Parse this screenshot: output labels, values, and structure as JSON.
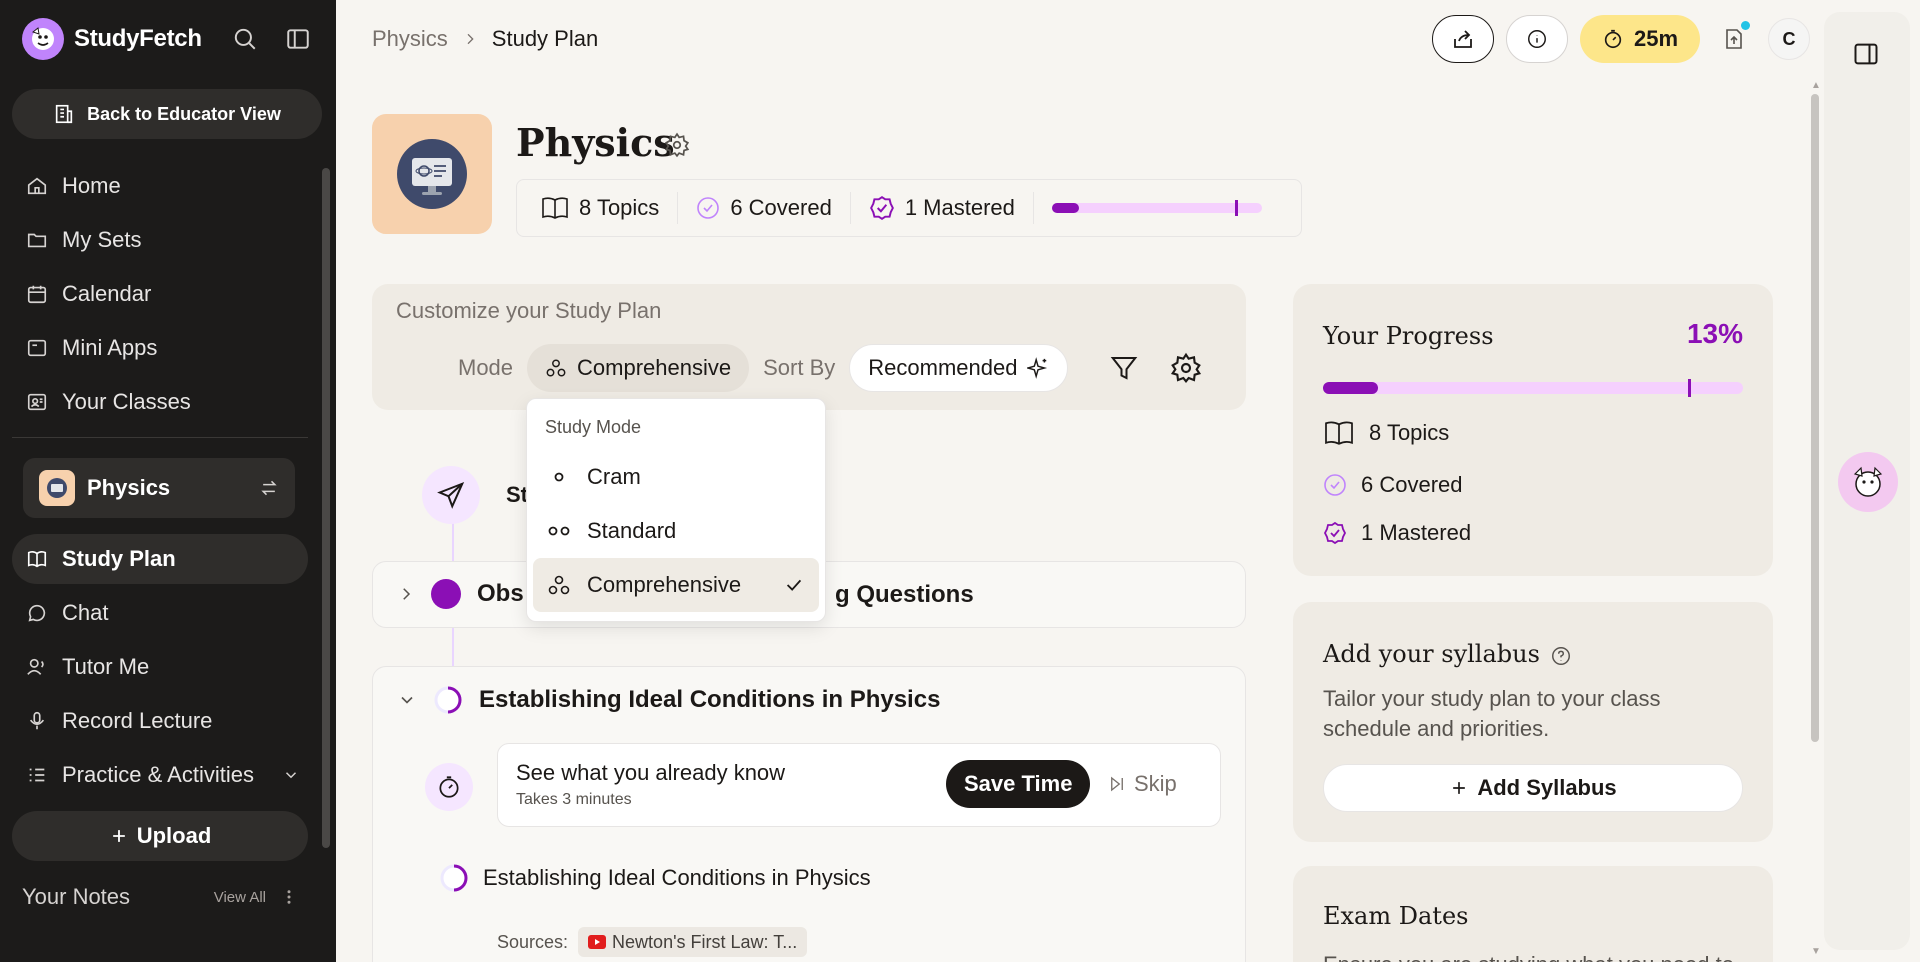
{
  "brand": {
    "name": "StudyFetch"
  },
  "sidebar": {
    "back_label": "Back to Educator View",
    "nav_top": [
      {
        "label": "Home",
        "icon": "home-icon"
      },
      {
        "label": "My Sets",
        "icon": "folder-icon"
      },
      {
        "label": "Calendar",
        "icon": "calendar-icon"
      },
      {
        "label": "Mini Apps",
        "icon": "app-icon"
      },
      {
        "label": "Your Classes",
        "icon": "classes-icon"
      }
    ],
    "current_class": "Physics",
    "nav_class": [
      {
        "label": "Study Plan",
        "icon": "book-icon",
        "active": true
      },
      {
        "label": "Chat",
        "icon": "chat-icon"
      },
      {
        "label": "Tutor Me",
        "icon": "tutor-icon"
      },
      {
        "label": "Record Lecture",
        "icon": "mic-icon"
      },
      {
        "label": "Practice & Activities",
        "icon": "list-icon"
      }
    ],
    "upload_label": "Upload",
    "notes_title": "Your Notes",
    "notes_view_all": "View All"
  },
  "breadcrumb": {
    "parent": "Physics",
    "current": "Study Plan"
  },
  "topbar": {
    "timer_label": "25m",
    "avatar_initial": "C"
  },
  "header": {
    "title": "Physics",
    "topics": "8 Topics",
    "covered": "6 Covered",
    "mastered": "1 Mastered",
    "progress": {
      "mastered_fraction": 0.13,
      "covered_fraction": 0.87
    }
  },
  "customize": {
    "title": "Customize your Study Plan",
    "mode_label": "Mode",
    "mode_value": "Comprehensive",
    "sort_label": "Sort By",
    "sort_value": "Recommended"
  },
  "dropdown": {
    "title": "Study Mode",
    "options": [
      {
        "label": "Cram",
        "selected": false
      },
      {
        "label": "Standard",
        "selected": false
      },
      {
        "label": "Comprehensive",
        "selected": true
      }
    ]
  },
  "plan": {
    "start_text": "St",
    "topic1_title_start": "Obs",
    "topic1_title_end": "g Questions",
    "topic2_title": "Establishing Ideal Conditions in Physics",
    "know_title": "See what you already know",
    "know_sub": "Takes 3 minutes",
    "save_label": "Save Time",
    "skip_label": "Skip",
    "subtopic": "Establishing Ideal Conditions in Physics",
    "sources_label": "Sources:",
    "source_chip": "Newton's First Law: T..."
  },
  "progress_card": {
    "title": "Your Progress",
    "percent": "13%",
    "topics": "8 Topics",
    "covered": "6 Covered",
    "mastered": "1 Mastered"
  },
  "syllabus_card": {
    "title": "Add your syllabus",
    "desc": "Tailor your study plan to your class schedule and priorities.",
    "button": "Add Syllabus"
  },
  "exam_card": {
    "title": "Exam Dates",
    "desc": "Ensure you are studying what you need to"
  },
  "colors": {
    "accent": "#8b0fb5",
    "timer_bg": "#fde68a",
    "sidebar_bg": "#1c1b1a"
  }
}
